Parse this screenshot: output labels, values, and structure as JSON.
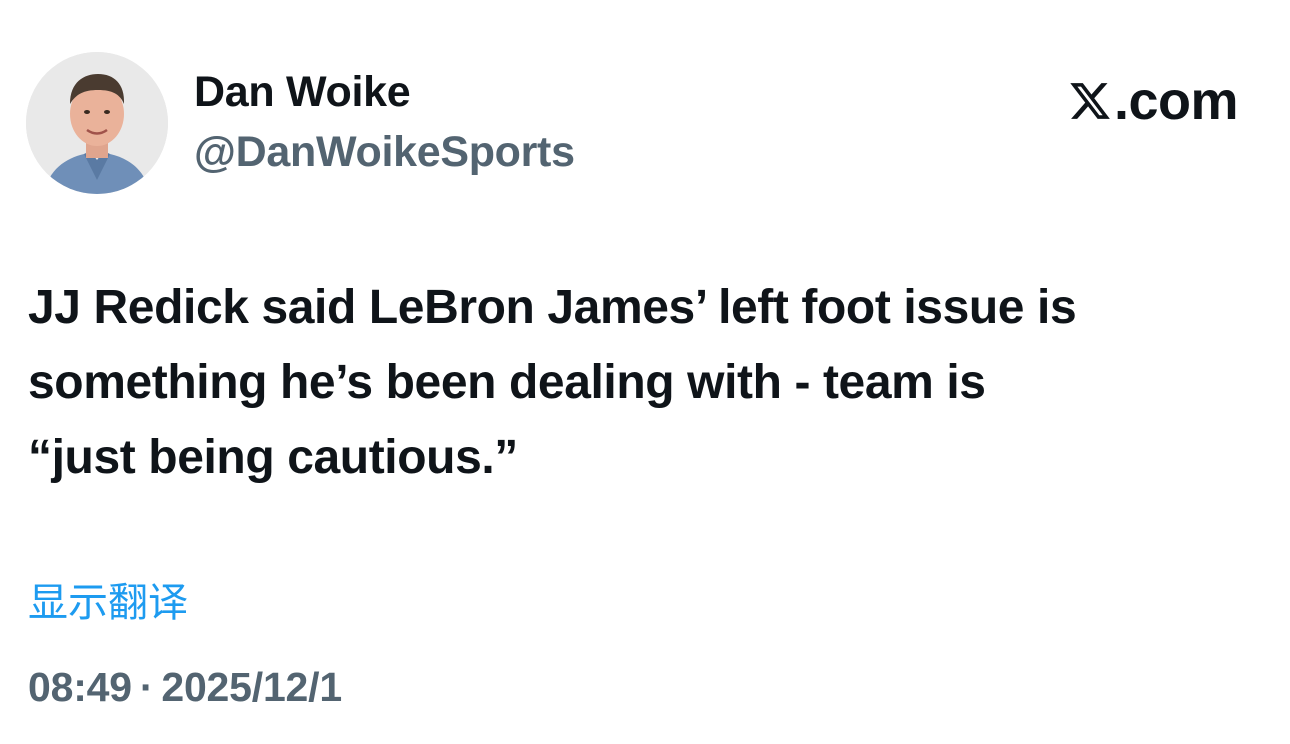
{
  "author": {
    "display_name": "Dan Woike",
    "handle": "@DanWoikeSports",
    "avatar_icon": "profile-photo-icon"
  },
  "brand": {
    "icon": "x-logo-icon",
    "suffix": ".com"
  },
  "tweet": {
    "text": "JJ Redick said LeBron James’ left foot issue is\nsomething he’s been dealing with - team is\n“just being cautious.”"
  },
  "translate": {
    "label": "显示翻译",
    "color": "#1d9bf0"
  },
  "meta": {
    "time": "08:49",
    "separator": "·",
    "date": "2025/12/1"
  },
  "colors": {
    "text_primary": "#0f1419",
    "text_secondary": "#536471",
    "link": "#1d9bf0",
    "background": "#ffffff"
  }
}
